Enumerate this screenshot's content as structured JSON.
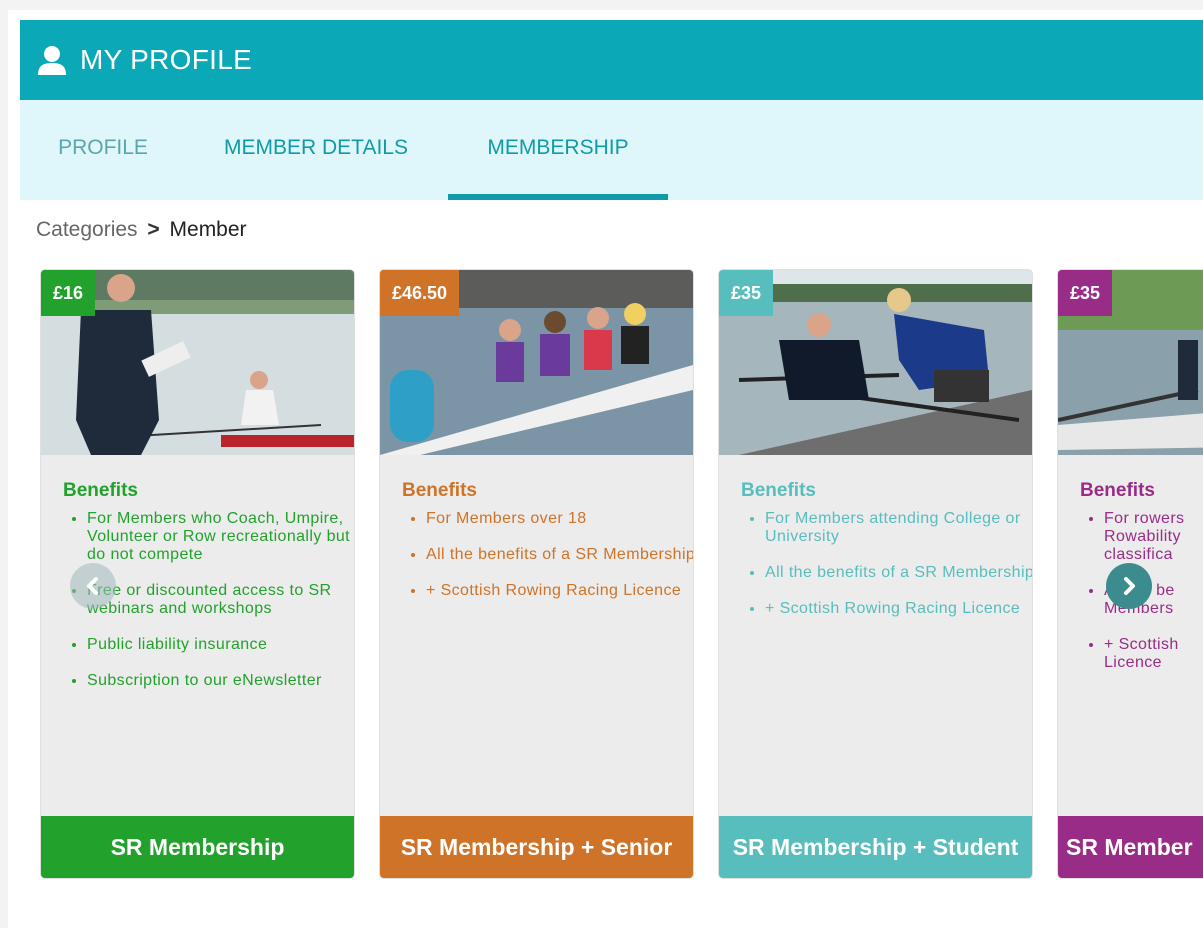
{
  "header": {
    "title": "MY PROFILE"
  },
  "tabs": [
    {
      "label": "PROFILE"
    },
    {
      "label": "MEMBER DETAILS"
    },
    {
      "label": "MEMBERSHIP"
    }
  ],
  "breadcrumb": {
    "parent": "Categories",
    "separator": ">",
    "current": "Member"
  },
  "colors": {
    "header": "#0ba8b8",
    "tabs_bg": "#dff6fb",
    "green": "#22a12c",
    "orange": "#cf7328",
    "teal": "#57bdbd",
    "purple": "#992c86"
  },
  "cards": [
    {
      "price": "£16",
      "benefits_title": "Benefits",
      "benefits": [
        "For Members who Coach, Umpire, Volunteer or Row recreationally but do not compete",
        "Free or discounted access to SR webinars and workshops",
        "Public liability insurance",
        "Subscription to our eNewsletter"
      ],
      "cta": "SR Membership"
    },
    {
      "price": "£46.50",
      "benefits_title": "Benefits",
      "benefits": [
        "For Members over 18",
        "All the benefits of a SR Membership",
        "+ Scottish Rowing Racing Licence"
      ],
      "cta": "SR Membership + Senior"
    },
    {
      "price": "£35",
      "benefits_title": "Benefits",
      "benefits": [
        "For Members attending College or University",
        "All the benefits of a SR Membership",
        "+ Scottish Rowing Racing Licence"
      ],
      "cta": "SR Membership + Student"
    },
    {
      "price": "£35",
      "benefits_title": "Benefits",
      "benefits": [
        "For rowers Rowability classifica",
        "All the be Members",
        "+ Scottish Licence"
      ],
      "cta": "SR Member"
    }
  ],
  "icons": {
    "header": "user-icon",
    "prev": "chevron-left-icon",
    "next": "chevron-right-icon"
  }
}
